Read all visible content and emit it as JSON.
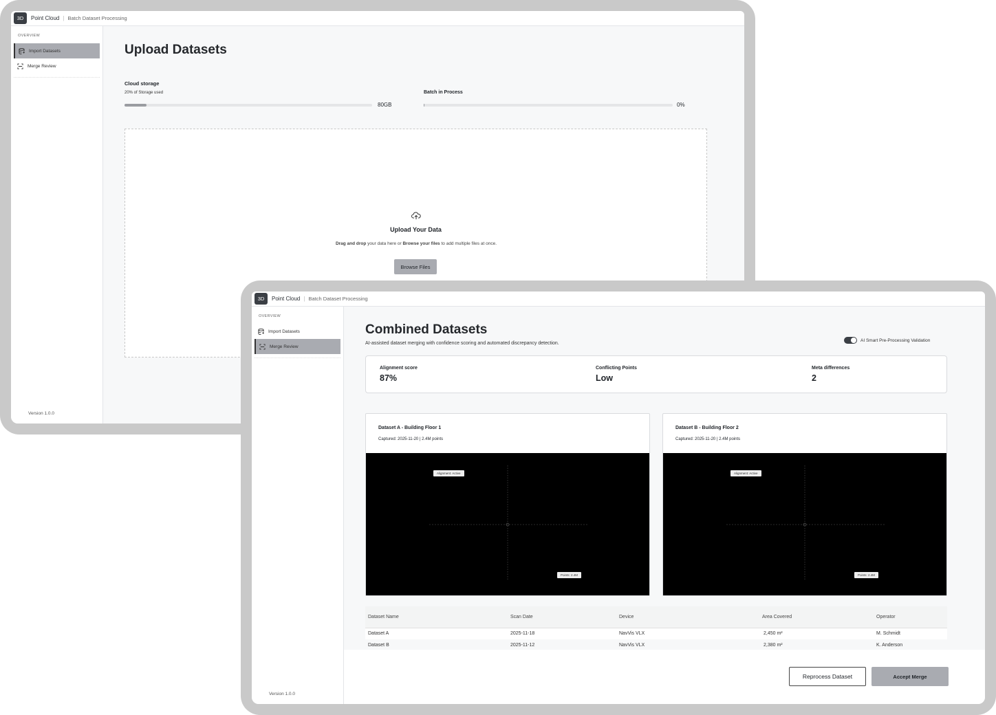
{
  "app": {
    "logo": "3D",
    "name": "Point Cloud",
    "breadcrumb": "Batch Dataset Processing"
  },
  "sidebar": {
    "section": "OVERVIEW",
    "items": [
      {
        "label": "Import Datasets",
        "icon": "database-import-icon"
      },
      {
        "label": "Merge Review",
        "icon": "merge-scan-icon"
      }
    ],
    "version": "Version 1.0.0"
  },
  "upload": {
    "title": "Upload Datasets",
    "storage": {
      "label": "Cloud storage",
      "sub": "20% of Storage used",
      "percent": 20,
      "value": "80GB"
    },
    "batch": {
      "label": "Batch in Process",
      "percent": 0,
      "value": "0%"
    },
    "dropzone": {
      "icon": "cloud-upload-icon",
      "title": "Upload Your Data",
      "drag": "Drag and drop",
      "mid": " your data here or ",
      "browse": "Browse your files",
      "tail": " to add multiple files at once.",
      "button": "Browse Files"
    }
  },
  "merge": {
    "title": "Combined Datasets",
    "subtitle": "AI-assisted dataset merging with confidence scoring and automated discrepancy detection.",
    "toggle": {
      "label": "AI Smart Pre-Processing Validation",
      "on": true
    },
    "stats": [
      {
        "label": "Alignment score",
        "value": "87%"
      },
      {
        "label": "Conflicting Points",
        "value": "Low"
      },
      {
        "label": "Meta differences",
        "value": "2"
      }
    ],
    "datasets": [
      {
        "title": "Dataset A - Building Floor 1",
        "meta": "Captured: 2025-11-20 | 2.4M points",
        "tag_top": "Alignment: Active",
        "tag_bottom": "Points: 2.4M"
      },
      {
        "title": "Dataset B - Building Floor 2",
        "meta": "Captured: 2025-11-20 | 2.4M points",
        "tag_top": "Alignment: Active",
        "tag_bottom": "Points: 2.4M"
      }
    ],
    "table": {
      "headers": [
        "Dataset Name",
        "Scan Date",
        "Device",
        "Area Covered",
        "Operator"
      ],
      "rows": [
        [
          "Dataset A",
          "2025-11-18",
          "NavVis VLX",
          "2,450 m²",
          "M. Schmidt"
        ],
        [
          "Dataset B",
          "2025-11-12",
          "NavVis VLX",
          "2,380 m²",
          "K. Anderson"
        ]
      ]
    },
    "buttons": {
      "reprocess": "Reprocess Dataset",
      "accept": "Accept Merge"
    }
  }
}
